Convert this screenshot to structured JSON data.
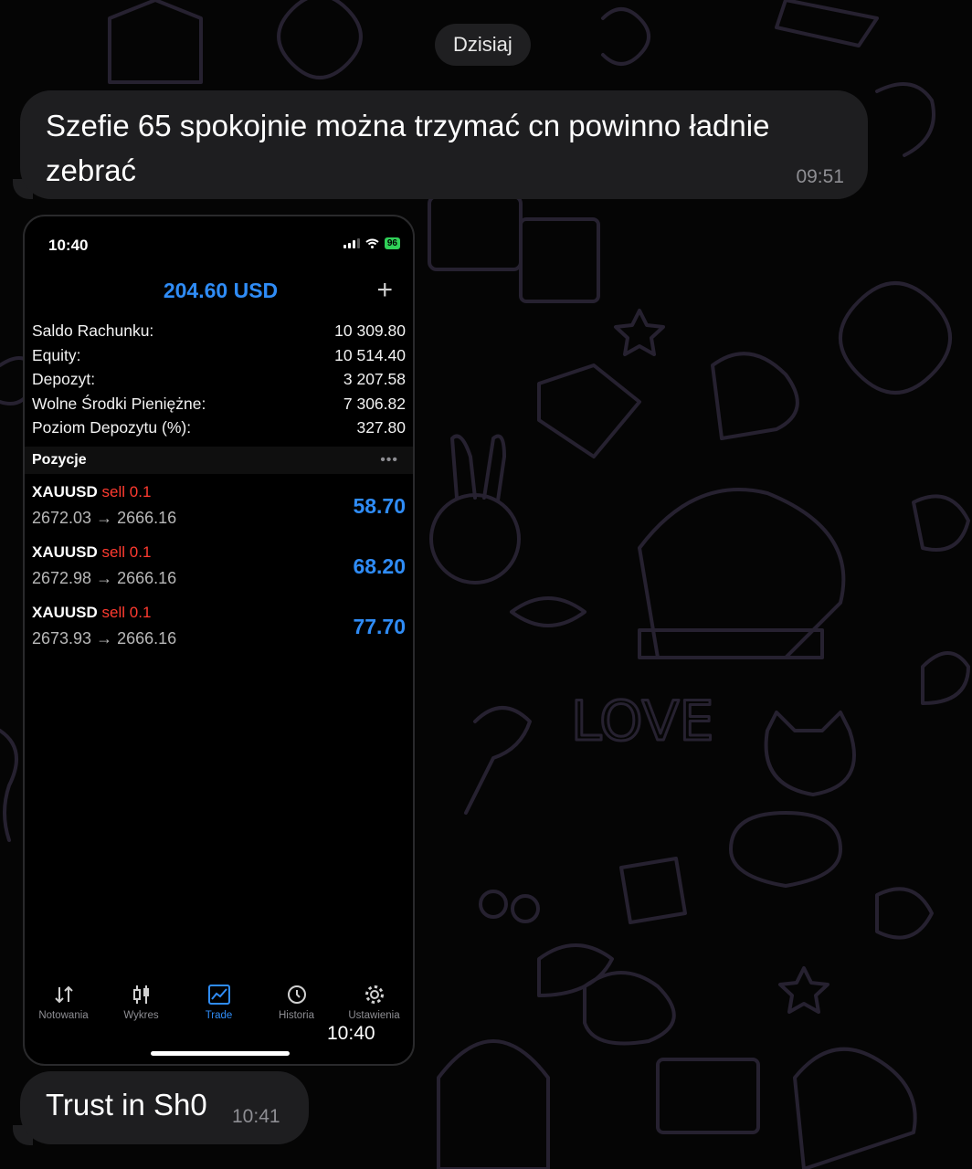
{
  "date_separator": "Dzisiaj",
  "messages": [
    {
      "text": "Szefie 65 spokojnie można trzymać cn powinno ładnie zebrać",
      "time": "09:51"
    },
    {
      "text": "Trust in Sh0",
      "time": "10:41"
    }
  ],
  "photo": {
    "time_overlay": "10:40",
    "status_bar": {
      "time": "10:40",
      "battery": "96"
    },
    "balance_header": "204.60 USD",
    "account": [
      {
        "label": "Saldo Rachunku:",
        "value": "10 309.80"
      },
      {
        "label": "Equity:",
        "value": "10 514.40"
      },
      {
        "label": "Depozyt:",
        "value": "3 207.58"
      },
      {
        "label": "Wolne Środki Pieniężne:",
        "value": "7 306.82"
      },
      {
        "label": "Poziom Depozytu (%):",
        "value": "327.80"
      }
    ],
    "positions_title": "Pozycje",
    "positions": [
      {
        "symbol": "XAUUSD",
        "side": "sell 0.1",
        "prices": "2672.03 → 2666.16",
        "profit": "58.70"
      },
      {
        "symbol": "XAUUSD",
        "side": "sell 0.1",
        "prices": "2672.98 → 2666.16",
        "profit": "68.20"
      },
      {
        "symbol": "XAUUSD",
        "side": "sell 0.1",
        "prices": "2673.93 → 2666.16",
        "profit": "77.70"
      }
    ],
    "tabs": [
      {
        "label": "Notowania",
        "icon": "arrows-icon"
      },
      {
        "label": "Wykres",
        "icon": "candles-icon"
      },
      {
        "label": "Trade",
        "icon": "trend-icon",
        "active": true
      },
      {
        "label": "Historia",
        "icon": "history-icon"
      },
      {
        "label": "Ustawienia",
        "icon": "gear-icon"
      }
    ]
  },
  "colors": {
    "accent": "#2f8cf6",
    "sell": "#ff3b30",
    "bubble": "#1e1e20"
  }
}
